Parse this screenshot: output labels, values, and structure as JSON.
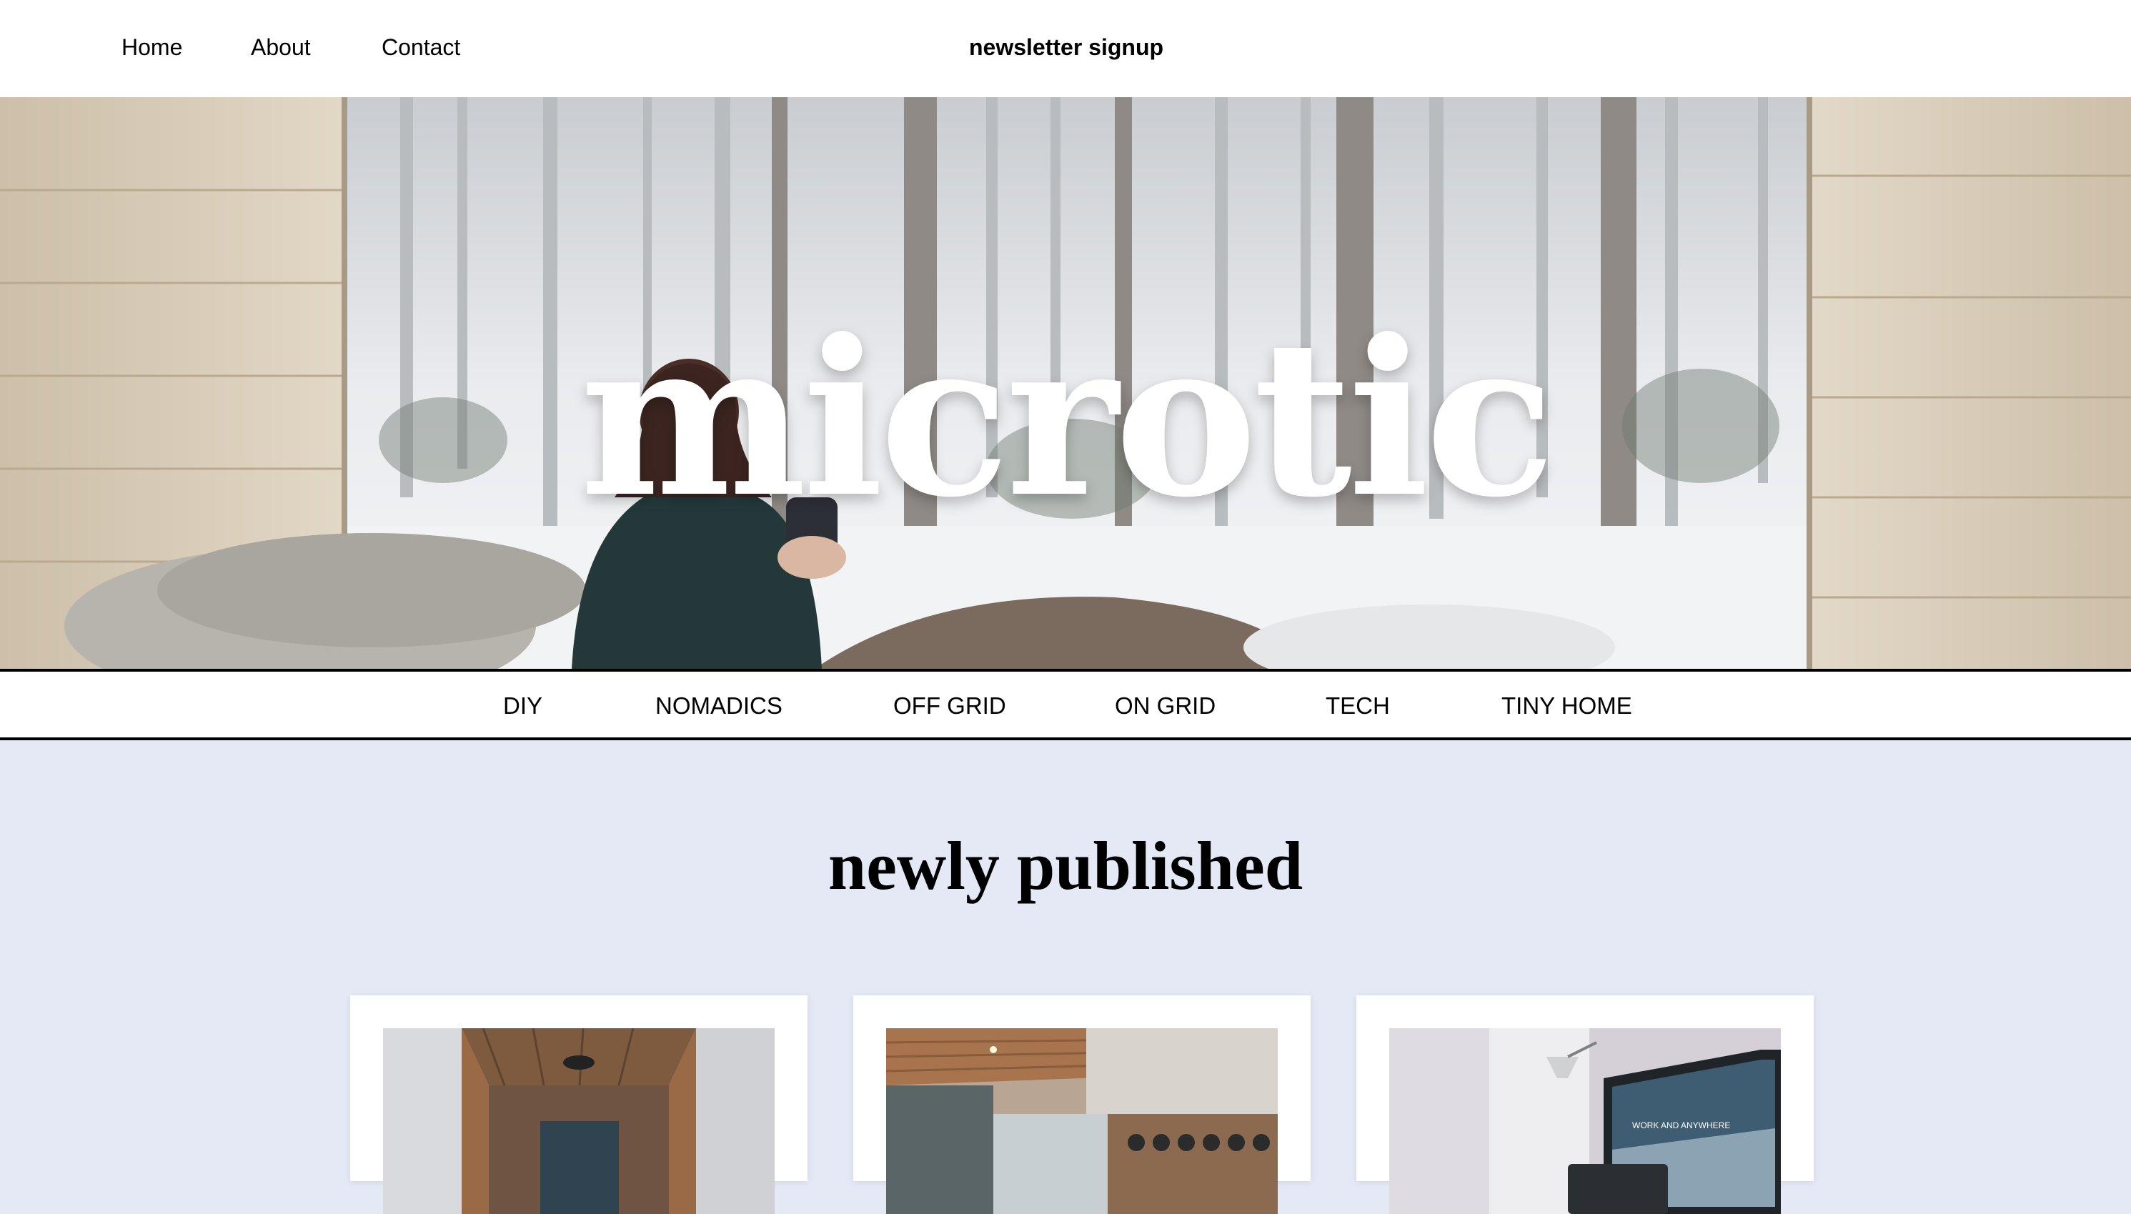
{
  "header": {
    "nav": [
      {
        "label": "Home"
      },
      {
        "label": "About"
      },
      {
        "label": "Contact"
      }
    ],
    "newsletter_label": "newsletter signup"
  },
  "hero": {
    "brand_name": "microtic"
  },
  "categories": [
    {
      "label": "DIY"
    },
    {
      "label": "NOMADICS"
    },
    {
      "label": "OFF GRID"
    },
    {
      "label": "ON GRID"
    },
    {
      "label": "TECH"
    },
    {
      "label": "TINY HOME"
    }
  ],
  "main": {
    "section_title": "newly published",
    "posts": [
      {
        "image": "van-interior-empty-photo"
      },
      {
        "image": "van-interior-kitchen-photo"
      },
      {
        "image": "desk-workspace-photo",
        "screen_text": "WORK AND ANYWHERE"
      }
    ]
  },
  "colors": {
    "page_background": "#e5e9f5",
    "header_background": "#ffffff",
    "text": "#000000",
    "wordmark": "#ffffff"
  }
}
